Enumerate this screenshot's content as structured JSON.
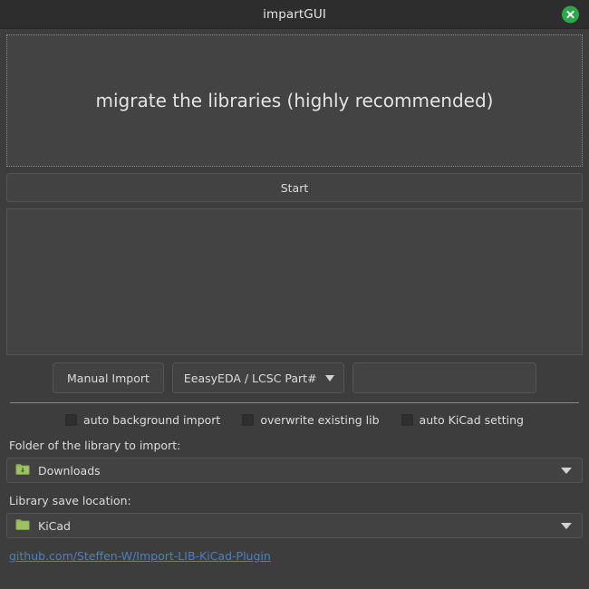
{
  "window": {
    "title": "impartGUI",
    "close_icon": "close-icon",
    "accent_close": "#2aa84a"
  },
  "migrate": {
    "message": "migrate the libraries (highly recommended)"
  },
  "actions": {
    "start_label": "Start"
  },
  "log": {
    "content": ""
  },
  "import_row": {
    "manual_import_label": "Manual Import",
    "part_source_selected": "EeasyEDA /  LCSC Part#",
    "part_number_value": "",
    "part_number_placeholder": ""
  },
  "options": [
    {
      "label": "auto background import",
      "checked": false
    },
    {
      "label": "overwrite existing lib",
      "checked": false
    },
    {
      "label": "auto KiCad setting",
      "checked": false
    }
  ],
  "import_folder": {
    "label": "Folder of the library to import:",
    "selected": "Downloads",
    "icon": "folder-download-icon"
  },
  "save_location": {
    "label": "Library save location:",
    "selected": "KiCad",
    "icon": "folder-icon"
  },
  "footer": {
    "link_text": "github.com/Steffen-W/Import-LIB-KiCad-Plugin",
    "link_color": "#4d7fc4"
  }
}
